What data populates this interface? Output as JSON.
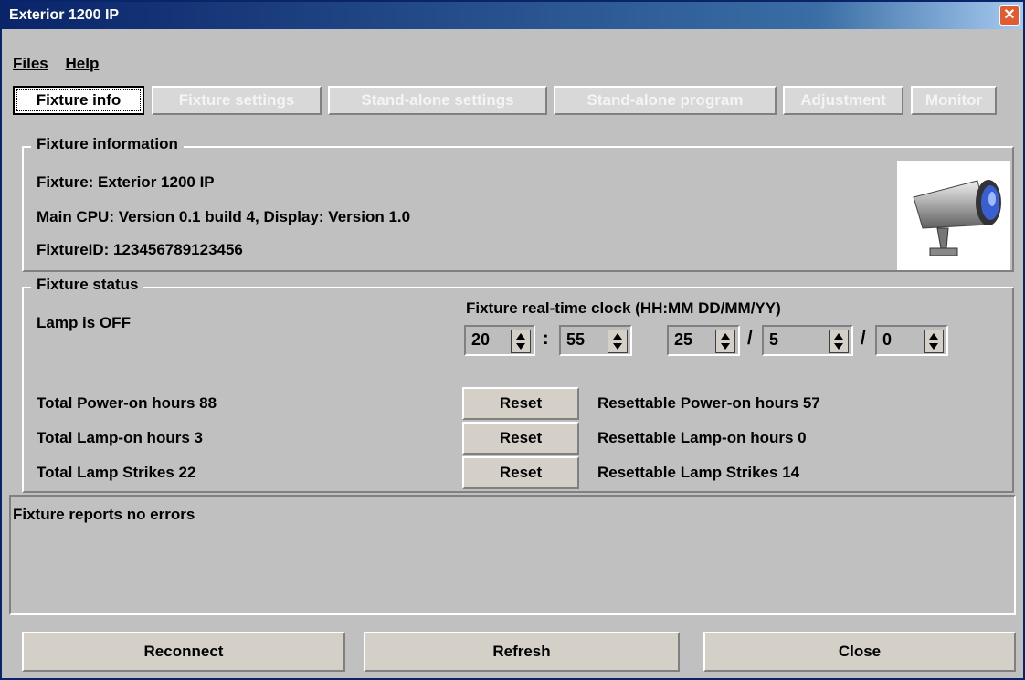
{
  "window": {
    "title": "Exterior 1200 IP",
    "close_glyph": "✕"
  },
  "menu": [
    {
      "label": "Files"
    },
    {
      "label": "Help"
    }
  ],
  "tabs": [
    {
      "label": "Fixture info",
      "active": true
    },
    {
      "label": "Fixture settings",
      "active": false
    },
    {
      "label": "Stand-alone settings",
      "active": false
    },
    {
      "label": "Stand-alone program",
      "active": false
    },
    {
      "label": "Adjustment",
      "active": false
    },
    {
      "label": "Monitor",
      "active": false
    }
  ],
  "info": {
    "legend": "Fixture information",
    "fixture": "Fixture: Exterior 1200 IP",
    "cpu": "Main CPU: Version 0.1 build 4,  Display: Version 1.0",
    "fixture_id": "FixtureID: 123456789123456",
    "image_icon": "fixture-image"
  },
  "status": {
    "legend": "Fixture status",
    "lamp": "Lamp is OFF",
    "clock_label": "Fixture real-time clock (HH:MM  DD/MM/YY)",
    "clock": {
      "hour": "20",
      "minute": "55",
      "day": "25",
      "month": "5",
      "year": "0"
    },
    "time_sep": ":",
    "date_sep": "/",
    "counters": [
      {
        "total": "Total Power-on hours 88",
        "reset": "Reset",
        "resettable": "Resettable Power-on hours 57"
      },
      {
        "total": "Total Lamp-on hours 3",
        "reset": "Reset",
        "resettable": "Resettable Lamp-on hours 0"
      },
      {
        "total": "Total Lamp Strikes 22",
        "reset": "Reset",
        "resettable": "Resettable Lamp Strikes 14"
      }
    ]
  },
  "errors": {
    "text": "Fixture reports no errors"
  },
  "footer": {
    "reconnect": "Reconnect",
    "refresh": "Refresh",
    "close": "Close"
  }
}
